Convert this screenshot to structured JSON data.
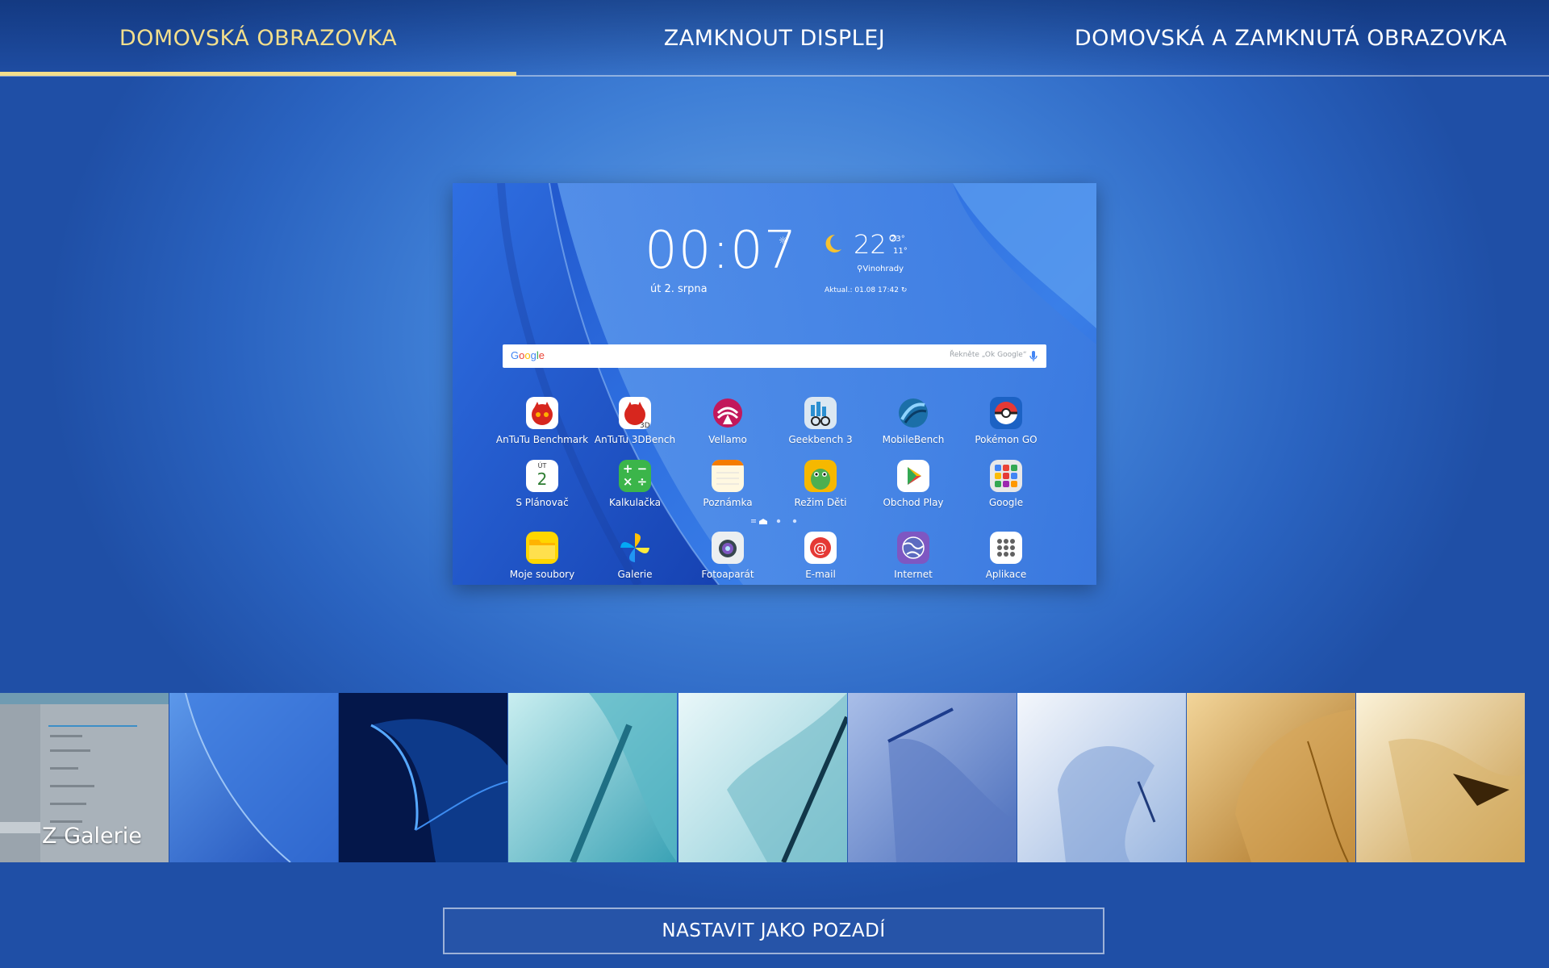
{
  "tabs": [
    {
      "label": "DOMOVSKÁ OBRAZOVKA",
      "active": true
    },
    {
      "label": "ZAMKNOUT DISPLEJ",
      "active": false
    },
    {
      "label": "DOMOVSKÁ A ZAMKNUTÁ OBRAZOVKA",
      "active": false
    }
  ],
  "accent_color": "#f3df8c",
  "preview": {
    "clock": "00:07",
    "date": "út 2. srpna",
    "weather": {
      "icon": "moon-icon",
      "temp": "22°",
      "high": "23°",
      "low": "11°",
      "location": "Vinohrady",
      "updated": "Aktual.: 01.08 17:42"
    },
    "search": {
      "logo": "Google",
      "hint": "Řekněte „Ok Google“"
    },
    "apps_row1": [
      {
        "label": "AnTuTu Benchmark",
        "icon": "antutu-icon"
      },
      {
        "label": "AnTuTu 3DBench",
        "icon": "antutu-3d-icon"
      },
      {
        "label": "Vellamo",
        "icon": "vellamo-icon"
      },
      {
        "label": "Geekbench 3",
        "icon": "geekbench-icon"
      },
      {
        "label": "MobileBench",
        "icon": "mobilebench-icon"
      },
      {
        "label": "Pokémon GO",
        "icon": "pokeball-icon"
      }
    ],
    "apps_row2": [
      {
        "label": "S Plánovač",
        "icon": "calendar-icon",
        "badge_top": "ÚT",
        "badge_num": "2"
      },
      {
        "label": "Kalkulačka",
        "icon": "calculator-icon"
      },
      {
        "label": "Poznámka",
        "icon": "notes-icon"
      },
      {
        "label": "Režim Děti",
        "icon": "kids-dino-icon"
      },
      {
        "label": "Obchod Play",
        "icon": "play-store-icon"
      },
      {
        "label": "Google",
        "icon": "google-folder-icon"
      }
    ],
    "dock": [
      {
        "label": "Moje soubory",
        "icon": "folder-icon"
      },
      {
        "label": "Galerie",
        "icon": "gallery-icon"
      },
      {
        "label": "Fotoaparát",
        "icon": "camera-icon"
      },
      {
        "label": "E-mail",
        "icon": "email-icon"
      },
      {
        "label": "Internet",
        "icon": "internet-globe-icon"
      },
      {
        "label": "Aplikace",
        "icon": "apps-grid-icon"
      }
    ]
  },
  "thumbnails": {
    "gallery_label": "Z Galerie",
    "wallpapers": [
      {
        "name": "blue-curves",
        "colors": [
          "#2a5fc7",
          "#4f8fe6"
        ]
      },
      {
        "name": "dark-blue-wave",
        "colors": [
          "#041a4a",
          "#1d6fd6"
        ]
      },
      {
        "name": "teal-wave",
        "colors": [
          "#3aa7b8",
          "#b9e6ea"
        ]
      },
      {
        "name": "light-teal-wave",
        "colors": [
          "#8fd0dc",
          "#e5f5f7"
        ]
      },
      {
        "name": "periwinkle-wave",
        "colors": [
          "#5d80c8",
          "#a8bde6"
        ]
      },
      {
        "name": "pale-blue-wave",
        "colors": [
          "#8fb0e0",
          "#eef3fb"
        ]
      },
      {
        "name": "gold-wave",
        "colors": [
          "#b47a22",
          "#f1cf8a"
        ]
      },
      {
        "name": "cream-gold-wave",
        "colors": [
          "#caa055",
          "#f7eac8"
        ]
      }
    ]
  },
  "set_button": "NASTAVIT JAKO POZADÍ"
}
